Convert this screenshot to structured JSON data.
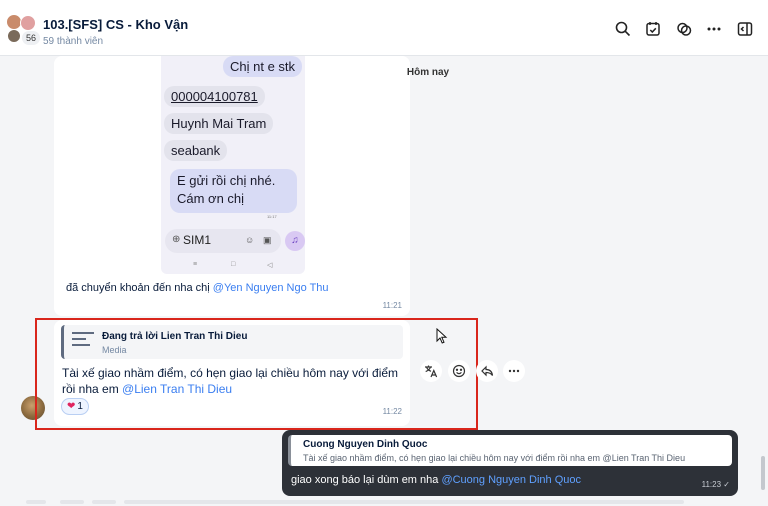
{
  "header": {
    "title": "103.[SFS] CS - Kho Vận",
    "member_count_badge": "56",
    "members_text": "59 thành viên",
    "icons": [
      "search-icon",
      "calendar-check-icon",
      "mention-threads-icon",
      "more-icon",
      "sidebar-toggle-icon"
    ]
  },
  "image_message": {
    "date_chip": "Hôm nay",
    "screenshot": {
      "bubble1": "Chị nt e stk",
      "account_number": "000004100781",
      "name": "Huynh Mai Tram",
      "bank": "seabank",
      "reply_line1": "E gửi rồi chị nhé.",
      "reply_line2": "Cám ơn chị",
      "input_placeholder": "SIM1"
    },
    "caption": "đã chuyển khoản đến nha chị ",
    "caption_mention": "@Yen Nguyen Ngo Thu",
    "time": "11:21"
  },
  "reply_message": {
    "quote_title": "Đang trả lời Lien Tran Thi Dieu",
    "quote_type": "Media",
    "text": "Tài xế giao nhầm điểm, có hẹn giao lại chiều hôm nay với điểm rồi nha em ",
    "mention": "@Lien Tran Thi Dieu",
    "reaction_count": "1",
    "time": "11:22",
    "actions": [
      "translate-icon",
      "emoji-icon",
      "reply-icon",
      "more-icon"
    ]
  },
  "own_message": {
    "quote_name": "Cuong Nguyen Dinh Quoc",
    "quote_text": "Tài xế giao nhầm điểm, có hẹn giao lại chiều hôm nay với điểm rồi nha em @Lien Tran Thi Dieu",
    "text": "giao xong báo lại dùm em nha ",
    "mention": "@Cuong Nguyen Dinh Quoc",
    "time": "11:23"
  },
  "colors": {
    "highlight": "#d9261c",
    "mention": "#3a7ef0",
    "own_bubble": "#2d3138"
  }
}
